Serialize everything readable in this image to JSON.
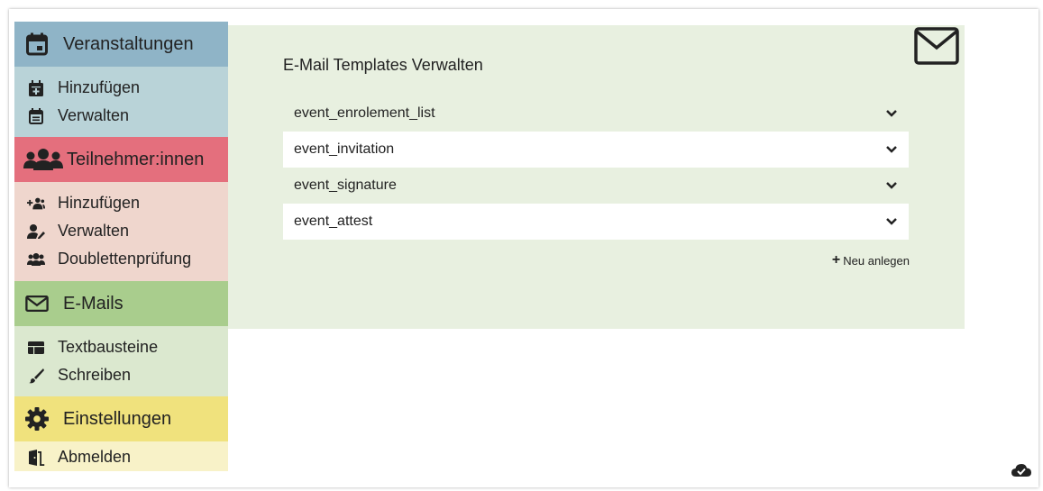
{
  "sidebar": {
    "veranstaltungen": {
      "title": "Veranstaltungen",
      "head_color": "#8fb4c7",
      "body_color": "#b9d3d8",
      "items": [
        {
          "label": "Hinzufügen",
          "icon": "calendar-plus-icon"
        },
        {
          "label": "Verwalten",
          "icon": "calendar-list-icon"
        }
      ]
    },
    "teilnehmer": {
      "title": "Teilnehmer:innen",
      "head_color": "#e46f7d",
      "body_color": "#efd6cd",
      "items": [
        {
          "label": "Hinzufügen",
          "icon": "user-plus-icon"
        },
        {
          "label": "Verwalten",
          "icon": "user-edit-icon"
        },
        {
          "label": "Doublettenprüfung",
          "icon": "users-icon"
        }
      ]
    },
    "emails": {
      "title": "E-Mails",
      "head_color": "#a9cd8d",
      "body_color": "#dbe8cf",
      "items": [
        {
          "label": "Textbausteine",
          "icon": "table-icon"
        },
        {
          "label": "Schreiben",
          "icon": "pen-icon"
        }
      ]
    },
    "einstellungen": {
      "title": "Einstellungen",
      "head_color": "#f0e27d",
      "body_color": "#f8f2c8",
      "items": [
        {
          "label": "Abmelden",
          "icon": "door-exit-icon"
        }
      ]
    }
  },
  "main": {
    "title": "E-Mail Templates Verwalten",
    "templates": [
      "event_enrolement_list",
      "event_invitation",
      "event_signature",
      "event_attest"
    ],
    "new_label": "Neu anlegen"
  }
}
